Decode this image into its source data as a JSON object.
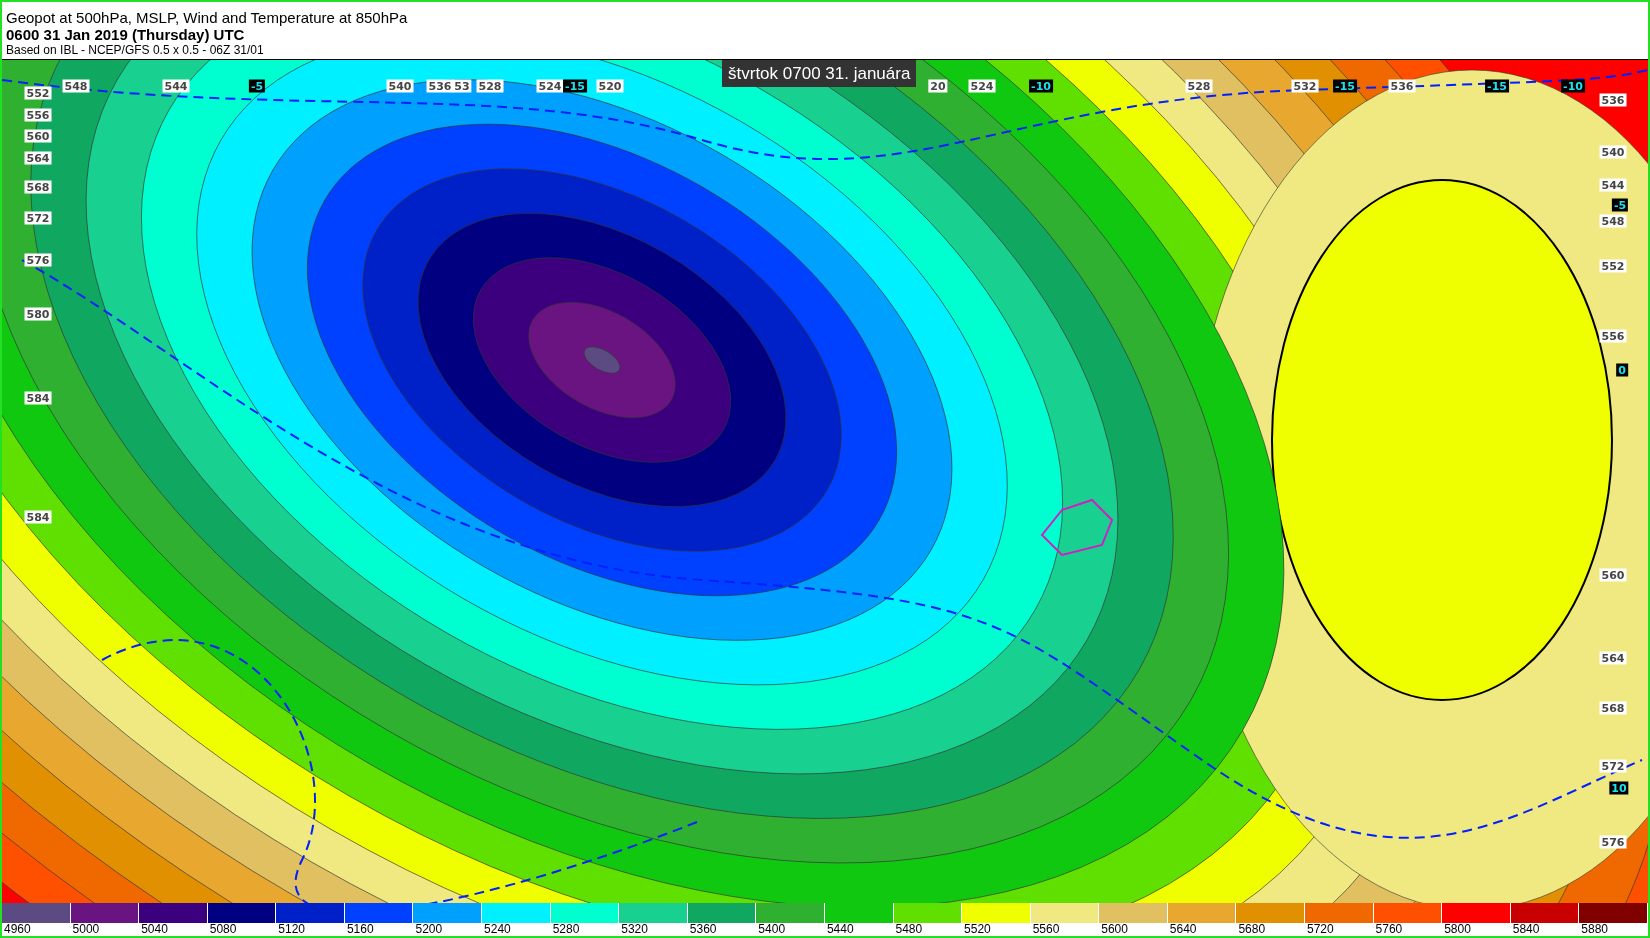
{
  "header": {
    "title": "Geopot at 500hPa, MSLP, Wind and Temperature at 850hPa",
    "valid_time": "0600 31 Jan 2019 (Thursday) UTC",
    "source": "Based on IBL - NCEP/GFS 0.5 x 0.5 - 06Z 31/01"
  },
  "map": {
    "tooltip": "štvrtok 0700 31. januára",
    "top_labels": [
      {
        "text": "548",
        "kind": "height"
      },
      {
        "text": "544",
        "kind": "height"
      },
      {
        "text": "-5",
        "kind": "temp"
      },
      {
        "text": "540",
        "kind": "height"
      },
      {
        "text": "536",
        "kind": "height"
      },
      {
        "text": "53",
        "kind": "height"
      },
      {
        "text": "528",
        "kind": "height"
      },
      {
        "text": "524",
        "kind": "height"
      },
      {
        "text": "-15",
        "kind": "temp"
      },
      {
        "text": "520",
        "kind": "height"
      },
      {
        "text": "20",
        "kind": "height"
      },
      {
        "text": "524",
        "kind": "height"
      },
      {
        "text": "-10",
        "kind": "temp"
      },
      {
        "text": "528",
        "kind": "height"
      },
      {
        "text": "532",
        "kind": "height"
      },
      {
        "text": "-15",
        "kind": "temp"
      },
      {
        "text": "536",
        "kind": "height"
      },
      {
        "text": "-15",
        "kind": "temp"
      },
      {
        "text": "-10",
        "kind": "temp"
      }
    ],
    "left_labels": [
      {
        "text": "552",
        "kind": "height"
      },
      {
        "text": "556",
        "kind": "height"
      },
      {
        "text": "560",
        "kind": "height"
      },
      {
        "text": "564",
        "kind": "height"
      },
      {
        "text": "568",
        "kind": "height"
      },
      {
        "text": "572",
        "kind": "height"
      },
      {
        "text": "576",
        "kind": "height"
      },
      {
        "text": "580",
        "kind": "height"
      },
      {
        "text": "584",
        "kind": "height"
      },
      {
        "text": "584",
        "kind": "height"
      }
    ],
    "right_labels": [
      {
        "text": "536",
        "kind": "height"
      },
      {
        "text": "540",
        "kind": "height"
      },
      {
        "text": "544",
        "kind": "height"
      },
      {
        "text": "-5",
        "kind": "temp"
      },
      {
        "text": "548",
        "kind": "height"
      },
      {
        "text": "552",
        "kind": "height"
      },
      {
        "text": "556",
        "kind": "height"
      },
      {
        "text": "0",
        "kind": "temp"
      },
      {
        "text": "560",
        "kind": "height"
      },
      {
        "text": "564",
        "kind": "height"
      },
      {
        "text": "568",
        "kind": "height"
      },
      {
        "text": "572",
        "kind": "height"
      },
      {
        "text": "10",
        "kind": "temp"
      },
      {
        "text": "576",
        "kind": "height"
      }
    ]
  },
  "legend": [
    {
      "label": "4960",
      "color": "#5c4b82"
    },
    {
      "label": "5000",
      "color": "#6a1482"
    },
    {
      "label": "5040",
      "color": "#3c007e"
    },
    {
      "label": "5080",
      "color": "#000080"
    },
    {
      "label": "5120",
      "color": "#0020c8"
    },
    {
      "label": "5160",
      "color": "#0040ff"
    },
    {
      "label": "5200",
      "color": "#00a0ff"
    },
    {
      "label": "5240",
      "color": "#00f0ff"
    },
    {
      "label": "5280",
      "color": "#00ffd0"
    },
    {
      "label": "5320",
      "color": "#18d090"
    },
    {
      "label": "5360",
      "color": "#10a860"
    },
    {
      "label": "5400",
      "color": "#30b030"
    },
    {
      "label": "5440",
      "color": "#10c810"
    },
    {
      "label": "5480",
      "color": "#60e000"
    },
    {
      "label": "5520",
      "color": "#f0ff00"
    },
    {
      "label": "5560",
      "color": "#f0e880"
    },
    {
      "label": "5600",
      "color": "#e0c060"
    },
    {
      "label": "5640",
      "color": "#e8a830"
    },
    {
      "label": "5680",
      "color": "#e09000"
    },
    {
      "label": "5720",
      "color": "#f06800"
    },
    {
      "label": "5760",
      "color": "#ff5000"
    },
    {
      "label": "5800",
      "color": "#ff0000"
    },
    {
      "label": "5840",
      "color": "#c80000"
    },
    {
      "label": "5880",
      "color": "#800000"
    }
  ]
}
